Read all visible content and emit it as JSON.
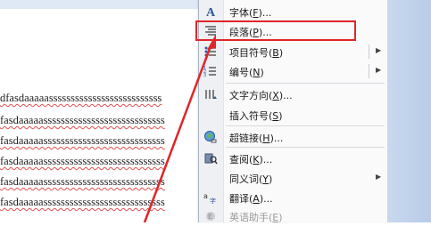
{
  "document": {
    "lines": [
      "dfasdaaaaassssssssssssssssssssssssss",
      "fasdaaaaassssssssssssssssssssssssssss",
      "fasdaaaaassssssssssssssssssssssssssss",
      "fasdaaaaassssssssssssssssssssssssssss",
      "fasdaaaaassssssssssssssssssssssssssss",
      "fasdaaaaassssssssssssssssssssssssssss"
    ]
  },
  "context_menu": {
    "items": [
      {
        "id": "font",
        "label": "字体(",
        "key": "F",
        "tail": ")...",
        "icon": "font-A-icon",
        "enabled": true,
        "submenu": false
      },
      {
        "id": "paragraph",
        "label": "段落(",
        "key": "P",
        "tail": ")...",
        "icon": "paragraph-icon",
        "enabled": true,
        "submenu": false
      },
      {
        "id": "bullets",
        "label": "项目符号(",
        "key": "B",
        "tail": ")",
        "icon": "bullets-icon",
        "enabled": true,
        "submenu": true
      },
      {
        "id": "numbering",
        "label": "编号(",
        "key": "N",
        "tail": ")",
        "icon": "numbering-icon",
        "enabled": true,
        "submenu": true
      },
      {
        "id": "text_direction",
        "label": "文字方向(",
        "key": "X",
        "tail": ")...",
        "icon": "text-direction-icon",
        "enabled": true,
        "submenu": false
      },
      {
        "id": "insert_symbol",
        "label": "插入符号(",
        "key": "S",
        "tail": ")",
        "icon": "",
        "enabled": true,
        "submenu": false
      },
      {
        "id": "hyperlink",
        "label": "超链接(",
        "key": "H",
        "tail": ")...",
        "icon": "hyperlink-globe-icon",
        "enabled": true,
        "submenu": false
      },
      {
        "id": "lookup",
        "label": "查阅(",
        "key": "K",
        "tail": ")...",
        "icon": "research-book-icon",
        "enabled": true,
        "submenu": false
      },
      {
        "id": "synonyms",
        "label": "同义词(",
        "key": "Y",
        "tail": ")",
        "icon": "",
        "enabled": true,
        "submenu": true
      },
      {
        "id": "translate",
        "label": "翻译(",
        "key": "A",
        "tail": ")...",
        "icon": "translate-icon",
        "enabled": true,
        "submenu": false
      },
      {
        "id": "english_assistant",
        "label": "英语助手(",
        "key": "E",
        "tail": ")",
        "icon": "english-assistant-icon",
        "enabled": false,
        "submenu": false
      }
    ]
  },
  "colors": {
    "highlight_box": "#e0262a",
    "arrow": "#e0262a",
    "menu_background": "#fafafa",
    "sidebar": "#c3d3ec"
  }
}
